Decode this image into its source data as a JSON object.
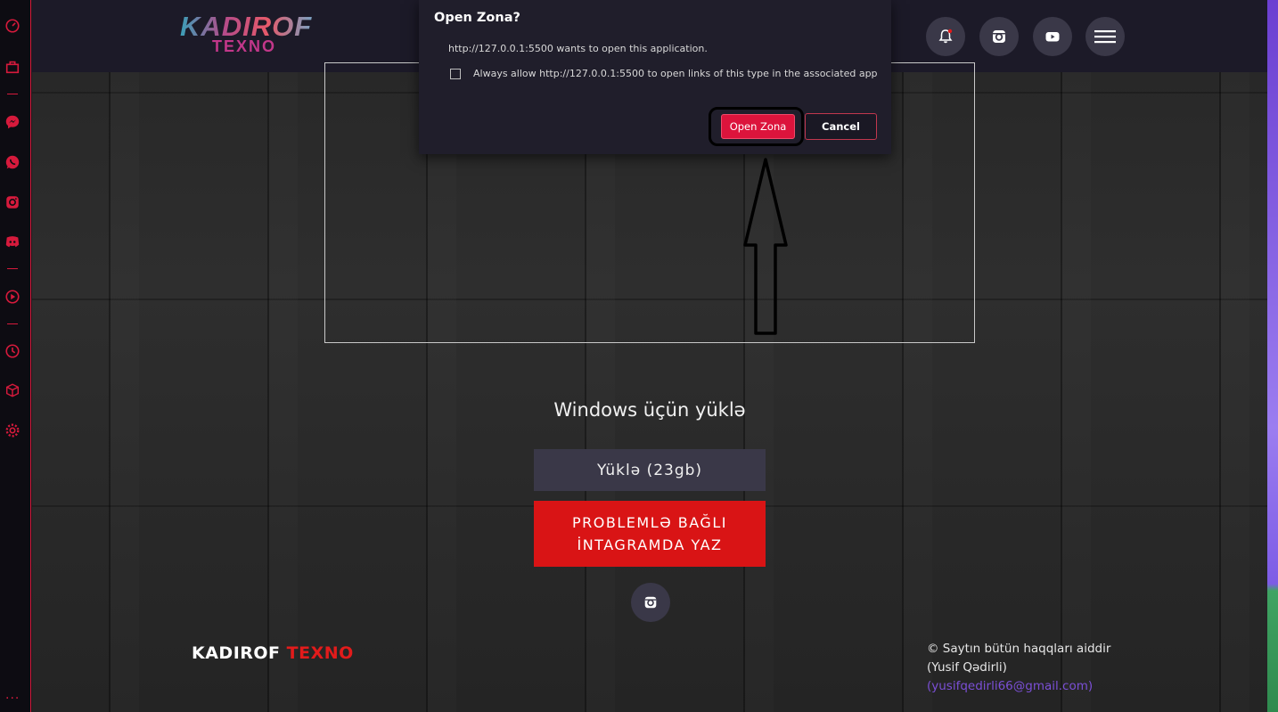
{
  "sidebar": {
    "icons": [
      {
        "name": "dashboard-icon"
      },
      {
        "name": "shop-icon"
      },
      {
        "name": "messenger-icon"
      },
      {
        "name": "whatsapp-icon"
      },
      {
        "name": "instagram-icon"
      },
      {
        "name": "discord-icon"
      },
      {
        "name": "play-icon"
      },
      {
        "name": "clock-icon"
      },
      {
        "name": "cube-icon"
      },
      {
        "name": "settings-icon"
      }
    ],
    "more_label": "..."
  },
  "header": {
    "logo_top": "KADIROF",
    "logo_bottom": "TEXNO",
    "buttons": [
      "bell-icon",
      "instagram-icon",
      "youtube-icon",
      "menu-icon"
    ]
  },
  "main": {
    "windows_title": "Windows üçün yüklə",
    "download_label": "Yüklə (23gb)",
    "problem_line1": "PROBLEMLƏ BAĞLI",
    "problem_line2": "İNTAGRAMDA YAZ"
  },
  "footer": {
    "brand_white": "KADIROF",
    "brand_red": "TEXNO",
    "copyright": "© Saytın bütün haqqları aiddir",
    "author": "(Yusif Qədirli)",
    "email": "(yusifqedirli66@gmail.com)"
  },
  "dialog": {
    "title": "Open Zona?",
    "message": "http://127.0.0.1:5500 wants to open this application.",
    "checkbox_label": "Always allow http://127.0.0.1:5500 to open links of this type in the associated app",
    "checkbox_checked": false,
    "open_label": "Open Zona",
    "cancel_label": "Cancel"
  },
  "colors": {
    "accent_red": "#dc143c",
    "brand_red": "#e21b1b",
    "email_purple": "#7b4fd6"
  }
}
